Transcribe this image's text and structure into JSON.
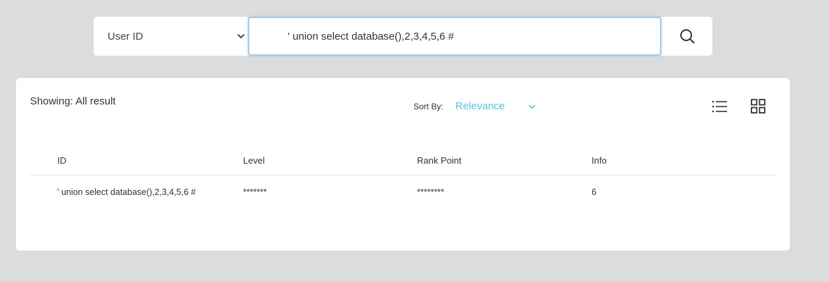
{
  "search": {
    "filter_selected": "User ID",
    "query_value": "' union select database(),2,3,4,5,6 #",
    "chevron_icon": "chevron-down-icon",
    "search_icon": "search-icon"
  },
  "results": {
    "showing_text": "Showing: All result",
    "sort_label": "Sort By:",
    "sort_selected": "Relevance",
    "accent_color": "#5bc2d6",
    "view_icons": [
      "list-view-icon",
      "grid-view-icon"
    ],
    "columns": [
      "ID",
      "Level",
      "Rank Point",
      "Info"
    ],
    "rows": [
      [
        "' union select database(),2,3,4,5,6 #",
        "*******",
        "********",
        "6"
      ]
    ]
  }
}
